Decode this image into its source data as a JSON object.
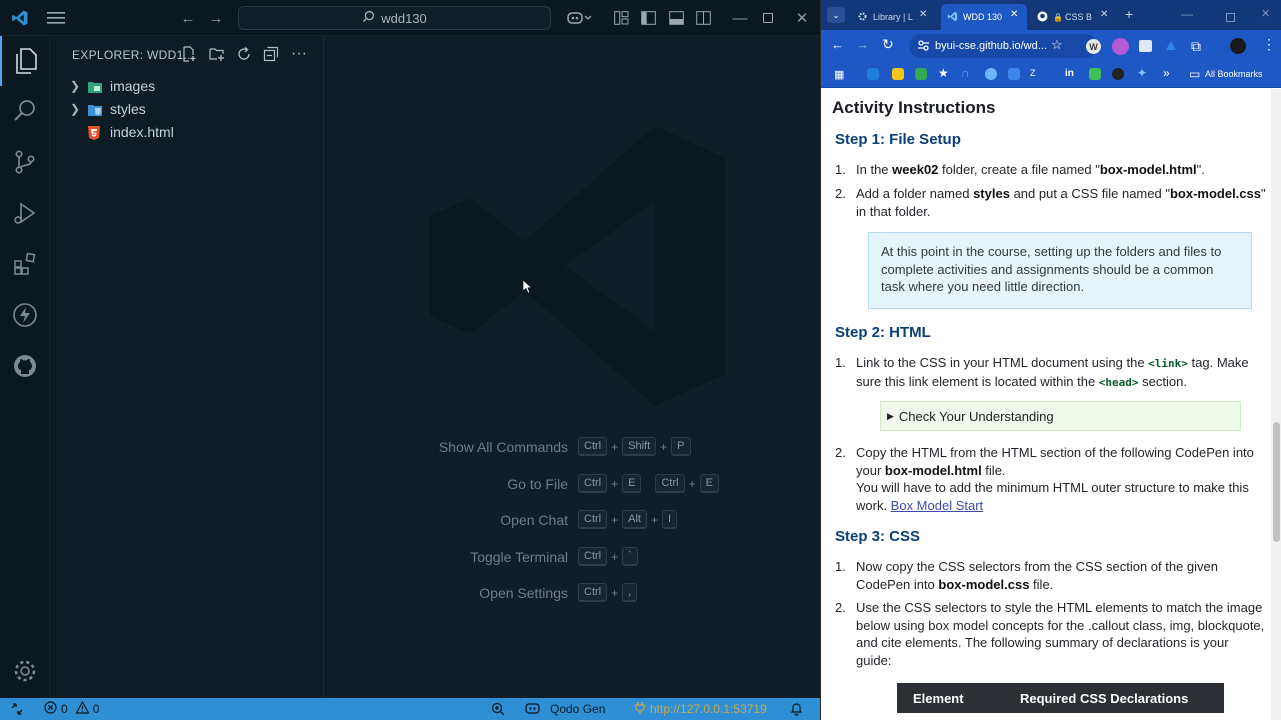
{
  "vscode": {
    "search_text": "wdd130",
    "explorer_title": "EXPLORER: WDD1...",
    "tree": [
      {
        "name": "images",
        "type": "folder"
      },
      {
        "name": "styles",
        "type": "folder"
      },
      {
        "name": "index.html",
        "type": "file"
      }
    ],
    "shortcuts": [
      {
        "label": "Show All Commands",
        "keys": [
          "Ctrl",
          "+",
          "Shift",
          "+",
          "P"
        ]
      },
      {
        "label": "Go to File",
        "keys": [
          "Ctrl",
          "+",
          "E",
          " ",
          "Ctrl",
          "+",
          "E"
        ]
      },
      {
        "label": "Open Chat",
        "keys": [
          "Ctrl",
          "+",
          "Alt",
          "+",
          "I"
        ]
      },
      {
        "label": "Toggle Terminal",
        "keys": [
          "Ctrl",
          "+",
          "`"
        ]
      },
      {
        "label": "Open Settings",
        "keys": [
          "Ctrl",
          "+",
          ","
        ]
      }
    ],
    "status": {
      "errors": "0",
      "warnings": "0",
      "qodo": "Qodo Gen",
      "url": "http://127.0.0.1:53719"
    },
    "colors": {
      "accent": "#2f8fd4",
      "background": "#0e1c25"
    }
  },
  "browser": {
    "tabs": [
      {
        "label": "Library | L"
      },
      {
        "label": "WDD 130"
      },
      {
        "label": "CSS B"
      }
    ],
    "address": "byui-cse.github.io/wd...",
    "bookmarks_label": "All Bookmarks",
    "page": {
      "heading": "Activity Instructions",
      "step1": {
        "title": "Step 1: File Setup",
        "item1": {
          "pre": "In the ",
          "b1": "week02",
          "mid": " folder, create a file named \"",
          "b2": "box-model.html",
          "post": "\"."
        },
        "item2": {
          "pre": "Add a folder named ",
          "b1": "styles",
          "mid": " and put a CSS file named \"",
          "b2": "box-model.css",
          "post": "\" in that folder."
        },
        "callout": "At this point in the course, setting up the folders and files to complete activities and assignments should be a common task where you need little direction."
      },
      "step2": {
        "title": "Step 2: HTML",
        "item1": {
          "pre": "Link to the CSS in your HTML document using the ",
          "code1": "<link>",
          "mid": " tag. Make sure this link element is located within the ",
          "code2": "<head>",
          "post": " section."
        },
        "check": "Check Your Understanding",
        "item2": {
          "pre": "Copy the HTML from the HTML section of the following CodePen into your ",
          "b1": "box-model.html",
          "mid": " file.",
          "line2": "You will have to add the minimum HTML outer structure to make this work. ",
          "link": "Box Model Start"
        }
      },
      "step3": {
        "title": "Step 3: CSS",
        "item1": {
          "pre": "Now copy the CSS selectors from the CSS section of the given CodePen into ",
          "b1": "box-model.css",
          "post": " file."
        },
        "item2": "Use the CSS selectors to style the HTML elements to match the image below using box model concepts for the .callout class, img, blockquote, and cite elements. The following summary of declarations is your guide:",
        "table_headers": [
          "Element",
          "Required CSS Declarations"
        ]
      },
      "numbers": [
        "1.",
        "2."
      ]
    }
  }
}
